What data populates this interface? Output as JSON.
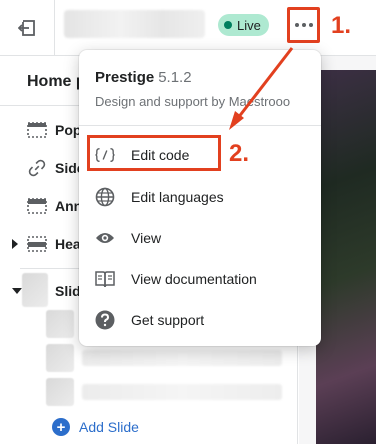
{
  "topbar": {
    "status_badge": "Live"
  },
  "annotations": {
    "step1": "1.",
    "step2": "2."
  },
  "sidebar": {
    "page_title": "Home p",
    "sections": [
      {
        "label": "Pop",
        "icon": "section-banner-icon"
      },
      {
        "label": "Side",
        "icon": "link-icon"
      },
      {
        "label": "Ann",
        "icon": "announcement-bar-icon"
      },
      {
        "label": "Hea",
        "icon": "header-icon"
      },
      {
        "label": "Slid",
        "icon": "slideshow-icon"
      }
    ],
    "add_slide_label": "Add Slide"
  },
  "theme_menu": {
    "theme_name": "Prestige",
    "theme_version": "5.1.2",
    "theme_support": "Design and support by Maestrooo",
    "items": [
      {
        "label": "Edit code",
        "icon": "code-icon"
      },
      {
        "label": "Edit languages",
        "icon": "globe-icon"
      },
      {
        "label": "View",
        "icon": "eye-icon"
      },
      {
        "label": "View documentation",
        "icon": "book-icon"
      },
      {
        "label": "Get support",
        "icon": "question-icon"
      }
    ]
  },
  "colors": {
    "annotation_red": "#e2401f",
    "live_badge_bg": "#aee9d1",
    "live_dot": "#007f5f",
    "link_blue": "#2c6ecb"
  }
}
